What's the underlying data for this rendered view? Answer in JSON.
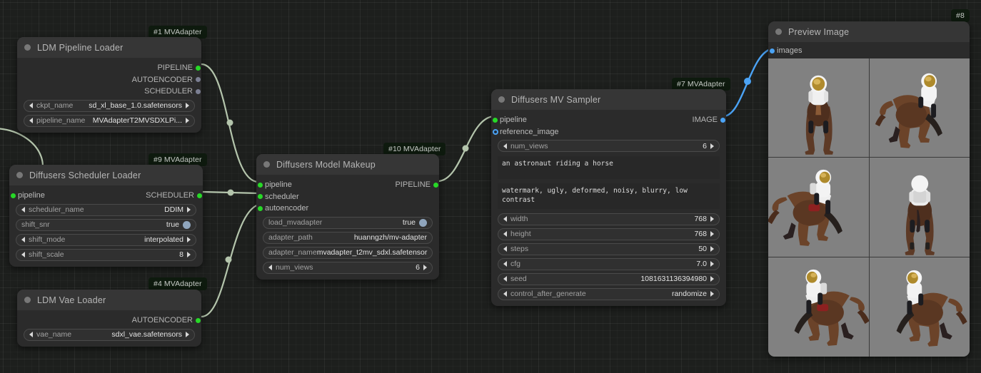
{
  "canvas": {
    "background": "#1d1f1d",
    "link_color_model": "#b4c5ac",
    "link_color_image": "#4ba3f5"
  },
  "nodes": [
    {
      "id": "ldm-pipeline-loader",
      "badge": "#1 MVAdapter",
      "title": "LDM Pipeline Loader",
      "inputs": [],
      "outputs": [
        {
          "label": "PIPELINE",
          "dot": "green"
        },
        {
          "label": "AUTOENCODER",
          "dot": "grey"
        },
        {
          "label": "SCHEDULER",
          "dot": "grey"
        }
      ],
      "widgets": [
        {
          "type": "combo",
          "name": "ckpt_name",
          "value": "sd_xl_base_1.0.safetensors"
        },
        {
          "type": "combo",
          "name": "pipeline_name",
          "value": "MVAdapterT2MVSDXLPi..."
        }
      ]
    },
    {
      "id": "diffusers-scheduler-loader",
      "badge": "#9 MVAdapter",
      "title": "Diffusers Scheduler Loader",
      "inputs": [
        {
          "label": "pipeline",
          "dot": "green"
        }
      ],
      "outputs": [
        {
          "label": "SCHEDULER",
          "dot": "green"
        }
      ],
      "widgets": [
        {
          "type": "combo",
          "name": "scheduler_name",
          "value": "DDIM"
        },
        {
          "type": "boolean",
          "name": "shift_snr",
          "value": "true"
        },
        {
          "type": "combo",
          "name": "shift_mode",
          "value": "interpolated"
        },
        {
          "type": "combo",
          "name": "shift_scale",
          "value": "8"
        }
      ]
    },
    {
      "id": "ldm-vae-loader",
      "badge": "#4 MVAdapter",
      "title": "LDM Vae Loader",
      "inputs": [],
      "outputs": [
        {
          "label": "AUTOENCODER",
          "dot": "green"
        }
      ],
      "widgets": [
        {
          "type": "combo",
          "name": "vae_name",
          "value": "sdxl_vae.safetensors"
        }
      ]
    },
    {
      "id": "diffusers-model-makeup",
      "badge": "#10 MVAdapter",
      "title": "Diffusers Model Makeup",
      "inputs": [
        {
          "label": "pipeline",
          "dot": "green"
        },
        {
          "label": "scheduler",
          "dot": "green"
        },
        {
          "label": "autoencoder",
          "dot": "green"
        }
      ],
      "outputs": [
        {
          "label": "PIPELINE",
          "dot": "green"
        }
      ],
      "widgets": [
        {
          "type": "boolean",
          "name": "load_mvadapter",
          "value": "true"
        },
        {
          "type": "text",
          "name": "adapter_path",
          "value": "huanngzh/mv-adapter"
        },
        {
          "type": "text",
          "name": "adapter_name",
          "value": "mvadapter_t2mv_sdxl.safetensor"
        },
        {
          "type": "combo",
          "name": "num_views",
          "value": "6"
        }
      ]
    },
    {
      "id": "diffusers-mv-sampler",
      "badge": "#7 MVAdapter",
      "title": "Diffusers MV Sampler",
      "inputs": [
        {
          "label": "pipeline",
          "dot": "green"
        },
        {
          "label": "reference_image",
          "dot": "hollow"
        }
      ],
      "outputs": [
        {
          "label": "IMAGE",
          "dot": "blue"
        }
      ],
      "widgets": [
        {
          "type": "combo",
          "name": "num_views",
          "value": "6"
        }
      ],
      "textareas": [
        {
          "name": "positive_prompt",
          "value": "an astronaut riding a horse"
        },
        {
          "name": "negative_prompt",
          "value": "watermark, ugly, deformed, noisy, blurry, low contrast"
        }
      ],
      "widgets2": [
        {
          "type": "combo",
          "name": "width",
          "value": "768"
        },
        {
          "type": "combo",
          "name": "height",
          "value": "768"
        },
        {
          "type": "combo",
          "name": "steps",
          "value": "50"
        },
        {
          "type": "combo",
          "name": "cfg",
          "value": "7.0"
        },
        {
          "type": "combo",
          "name": "seed",
          "value": "1081631136394980"
        },
        {
          "type": "combo",
          "name": "control_after_generate",
          "value": "randomize"
        }
      ]
    },
    {
      "id": "preview-image",
      "badge": "#8",
      "title": "Preview Image",
      "inputs": [
        {
          "label": "images",
          "dot": "blue"
        }
      ],
      "outputs": [],
      "widgets": [],
      "preview": {
        "count": 6,
        "background": "#818181",
        "views": [
          "astronaut-on-horse-front",
          "astronaut-on-horse-front-right",
          "astronaut-on-horse-left-profile",
          "astronaut-on-horse-rear",
          "astronaut-on-horse-right-profile",
          "astronaut-on-horse-rear-right"
        ]
      }
    }
  ]
}
